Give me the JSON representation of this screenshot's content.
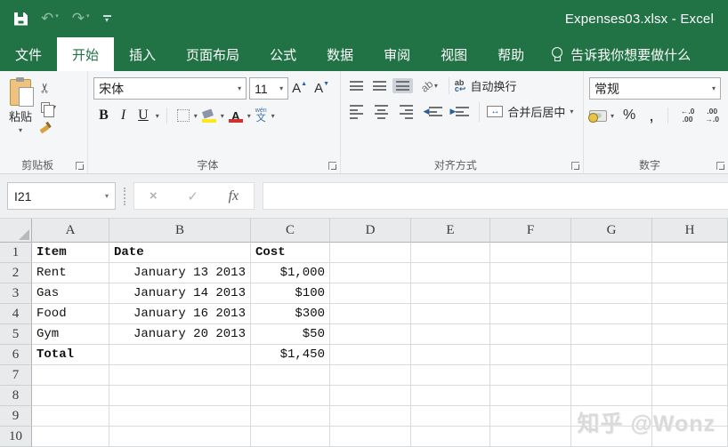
{
  "title_bar": {
    "title": "Expenses03.xlsx  -  Excel"
  },
  "tabs": [
    {
      "label": "文件"
    },
    {
      "label": "开始"
    },
    {
      "label": "插入"
    },
    {
      "label": "页面布局"
    },
    {
      "label": "公式"
    },
    {
      "label": "数据"
    },
    {
      "label": "审阅"
    },
    {
      "label": "视图"
    },
    {
      "label": "帮助"
    }
  ],
  "tell_me": {
    "label": "告诉我你想要做什么"
  },
  "ribbon": {
    "clipboard": {
      "paste_label": "粘贴",
      "group_label": "剪贴板"
    },
    "font": {
      "font_name": "宋体",
      "font_size": "11",
      "group_label": "字体"
    },
    "alignment": {
      "wrap_label": "自动换行",
      "merge_label": "合并后居中",
      "group_label": "对齐方式"
    },
    "number": {
      "format": "常规",
      "group_label": "数字"
    }
  },
  "formula_bar": {
    "name_box": "I21"
  },
  "icons": {
    "dropdown": "▾",
    "undo": "↶",
    "redo": "↷",
    "scissors": "✂",
    "cancel": "×",
    "check": "✓",
    "fx": "fx",
    "bold": "B",
    "italic": "I",
    "underline": "U",
    "grow_font": "A",
    "shrink_font": "A",
    "caret_up": "▲",
    "caret_dn": "▼",
    "font_color_letter": "A",
    "pinyin_top": "wén",
    "pinyin_main": "文",
    "orient": "ab",
    "wrap_top": "ab",
    "wrap_bot": "c↩",
    "indent_left": "◀",
    "indent_right": "▶",
    "merge_arrows": "↔",
    "percent": "%",
    "comma": ",",
    "inc_dec_top": "←.0",
    "inc_dec_bot": ".00",
    "dec_dec_top": ".00",
    "dec_dec_bot": "→.0"
  },
  "grid": {
    "columns": [
      "A",
      "B",
      "C",
      "D",
      "E",
      "F",
      "G",
      "H"
    ],
    "row_numbers": [
      "1",
      "2",
      "3",
      "4",
      "5",
      "6",
      "7",
      "8",
      "9",
      "10"
    ],
    "cells": {
      "A1": {
        "t": "Item",
        "b": true
      },
      "B1": {
        "t": "Date",
        "b": true
      },
      "C1": {
        "t": "Cost",
        "b": true
      },
      "A2": {
        "t": "Rent"
      },
      "B2": {
        "t": "January 13 2013",
        "r": true
      },
      "C2": {
        "t": "$1,000",
        "r": true
      },
      "A3": {
        "t": "Gas"
      },
      "B3": {
        "t": "January 14 2013",
        "r": true
      },
      "C3": {
        "t": "$100",
        "r": true
      },
      "A4": {
        "t": "Food"
      },
      "B4": {
        "t": "January 16 2013",
        "r": true
      },
      "C4": {
        "t": "$300",
        "r": true
      },
      "A5": {
        "t": "Gym"
      },
      "B5": {
        "t": "January 20 2013",
        "r": true
      },
      "C5": {
        "t": "$50",
        "r": true
      },
      "A6": {
        "t": "Total",
        "b": true
      },
      "C6": {
        "t": "$1,450",
        "r": true
      }
    }
  },
  "watermark": {
    "text": "知乎 @Wonz"
  }
}
